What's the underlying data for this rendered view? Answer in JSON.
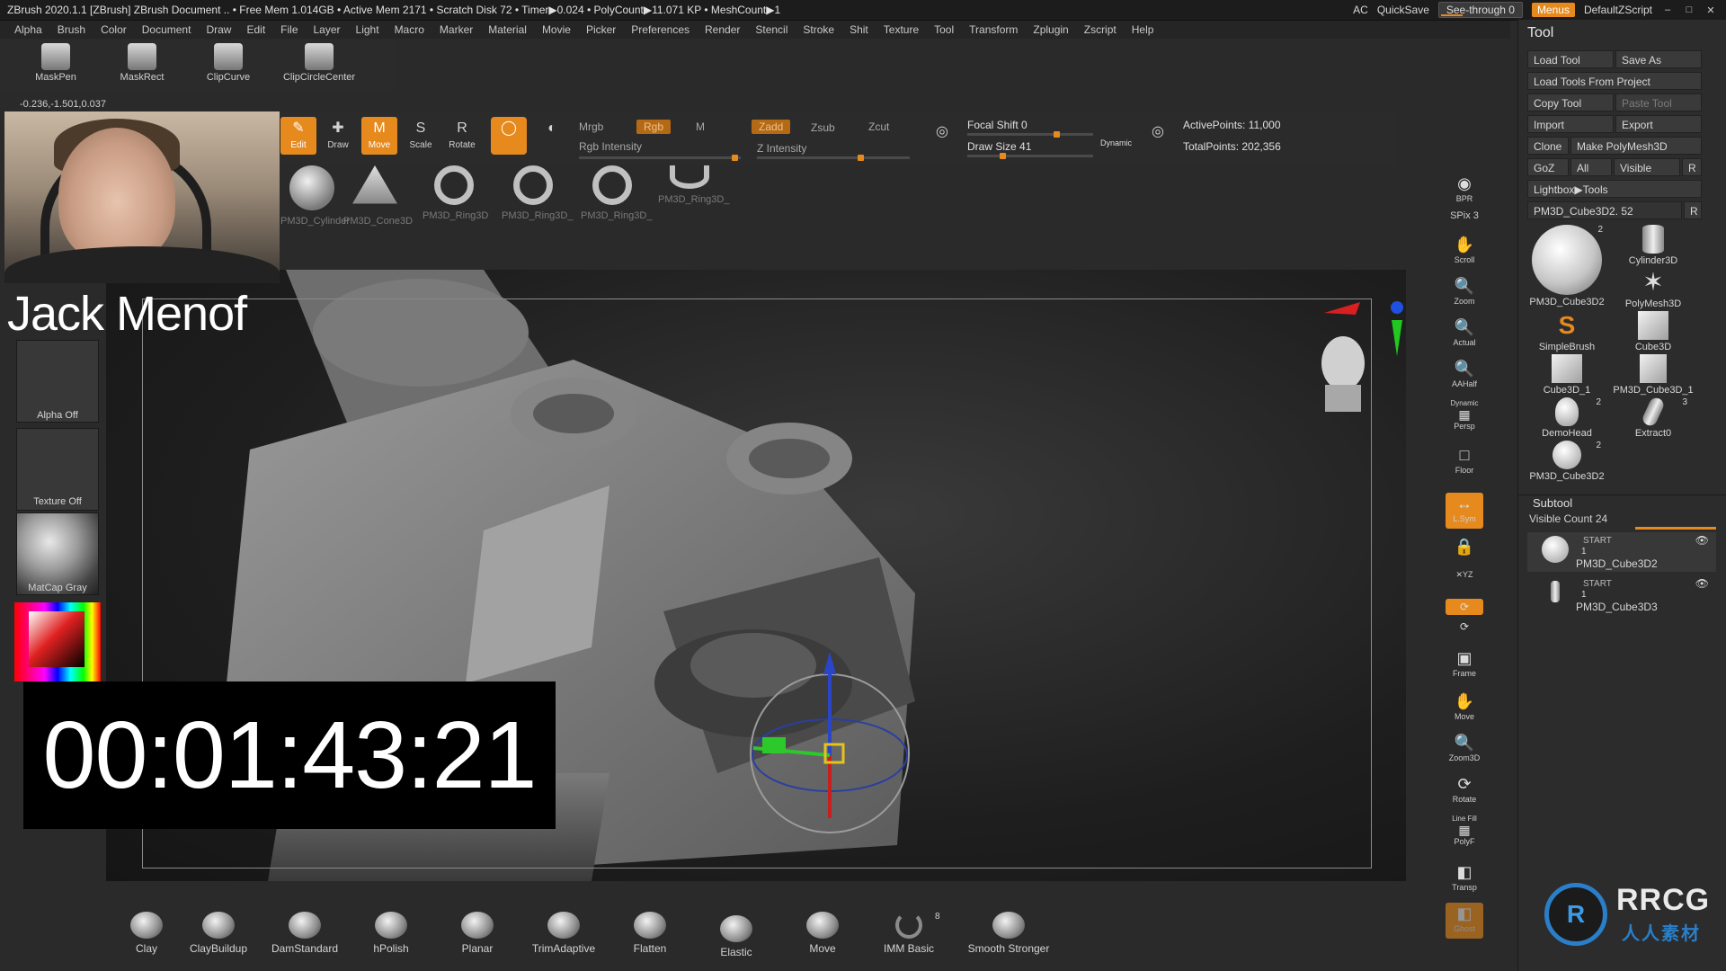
{
  "titlebar": {
    "title": "ZBrush 2020.1.1 [ZBrush]   ZBrush Document    .. • Free Mem 1.014GB • Active Mem 2171 • Scratch Disk 72 • Timer▶0.024 • PolyCount▶11.071 KP • MeshCount▶1",
    "ac": "AC",
    "quicksave": "QuickSave",
    "see_through": "See-through  0",
    "menus": "Menus",
    "default_zscript": "DefaultZScript"
  },
  "menubar": {
    "items": [
      "Alpha",
      "Brush",
      "Color",
      "Document",
      "Draw",
      "Edit",
      "File",
      "Layer",
      "Light",
      "Macro",
      "Marker",
      "Material",
      "Movie",
      "Picker",
      "Preferences",
      "Render",
      "Stencil",
      "Stroke",
      "Shit",
      "Texture",
      "Tool",
      "Transform",
      "Zplugin",
      "Zscript",
      "Help"
    ]
  },
  "shelf": {
    "items": [
      "MaskPen",
      "MaskRect",
      "ClipCurve",
      "ClipCircleCenter"
    ]
  },
  "coords": "-0.236,-1.501,0.037",
  "presenter_name": "Jack Menof",
  "left_tray": {
    "alpha": "Alpha Off",
    "texture": "Texture Off",
    "matcap": "MatCap Gray"
  },
  "timer": "00:01:43:21",
  "toolbar": {
    "edit": "Edit",
    "draw": "Draw",
    "move": "Move",
    "scale": "Scale",
    "rotate": "Rotate",
    "mrgb": "Mrgb",
    "rgb": "Rgb",
    "m": "M",
    "rgb_intensity": "Rgb Intensity",
    "zadd": "Zadd",
    "zsub": "Zsub",
    "zcut": "Zcut",
    "z_intensity": "Z Intensity",
    "focal_shift": "Focal Shift 0",
    "draw_size": "Draw Size 41",
    "dynamic": "Dynamic",
    "active_points": "ActivePoints: 11,000",
    "total_points": "TotalPoints: 202,356"
  },
  "brush_shelf": {
    "items": [
      "PM3D_Cylinder",
      "PM3D_Cone3D",
      "PM3D_Ring3D",
      "PM3D_Ring3D_",
      "PM3D_Ring3D_",
      "PM3D_Ring3D_"
    ]
  },
  "right_icons": {
    "bpr": "BPR",
    "spix": "SPix 3",
    "scroll": "Scroll",
    "zoom": "Zoom",
    "actual": "Actual",
    "aahalf": "AAHalf",
    "persp": "Persp",
    "dynamic": "Dynamic",
    "floor": "Floor",
    "lsym": "L.Sym",
    "xyz": "✕YZ",
    "frame": "Frame",
    "move": "Move",
    "zoom3d": "Zoom3D",
    "rotate": "Rotate",
    "linefill": "Line Fill",
    "polyf": "PolyF",
    "transp": "Transp",
    "ghost": "Ghost"
  },
  "tool_panel": {
    "title": "Tool",
    "load_tool": "Load Tool",
    "save_as": "Save As",
    "load_tools_from_project": "Load Tools From Project",
    "copy_tool": "Copy Tool",
    "paste_tool": "Paste Tool",
    "import": "Import",
    "export": "Export",
    "clone": "Clone",
    "make_polymesh": "Make PolyMesh3D",
    "goz": "GoZ",
    "all": "All",
    "visible": "Visible",
    "r": "R",
    "lightbox_tools": "Lightbox▶Tools",
    "current_tool": "PM3D_Cube3D2. 52",
    "tools": [
      {
        "name": "PM3D_Cube3D2",
        "badge": "2"
      },
      {
        "name": "Cylinder3D",
        "badge": ""
      },
      {
        "name": "PolyMesh3D",
        "badge": ""
      },
      {
        "name": "SimpleBrush",
        "badge": ""
      },
      {
        "name": "Cube3D",
        "badge": ""
      },
      {
        "name": "Cube3D_1",
        "badge": ""
      },
      {
        "name": "PM3D_Cube3D_1",
        "badge": ""
      },
      {
        "name": "DemoHead",
        "badge": "2"
      },
      {
        "name": "Extract0",
        "badge": "3"
      },
      {
        "name": "PM3D_Cube3D2",
        "badge": "2"
      }
    ],
    "subtool": {
      "title": "Subtool",
      "visible_count": "Visible Count 24",
      "items": [
        {
          "name": "PM3D_Cube3D2",
          "tag": "START",
          "num": "1"
        },
        {
          "name": "PM3D_Cube3D3",
          "tag": "START",
          "num": "1"
        }
      ]
    }
  },
  "bottom_brushes": {
    "items": [
      "Clay",
      "ClayBuildup",
      "DamStandard",
      "hPolish",
      "Planar",
      "TrimAdaptive",
      "Flatten",
      "Elastic",
      "Move",
      "IMM Basic",
      "Smooth Stronger"
    ],
    "imm_badge": "8"
  },
  "logo": {
    "badge": "R",
    "text": "RRCG",
    "sub": "人人素材"
  },
  "colors": {
    "accent": "#e68a1e",
    "bg": "#2a2a2a"
  }
}
